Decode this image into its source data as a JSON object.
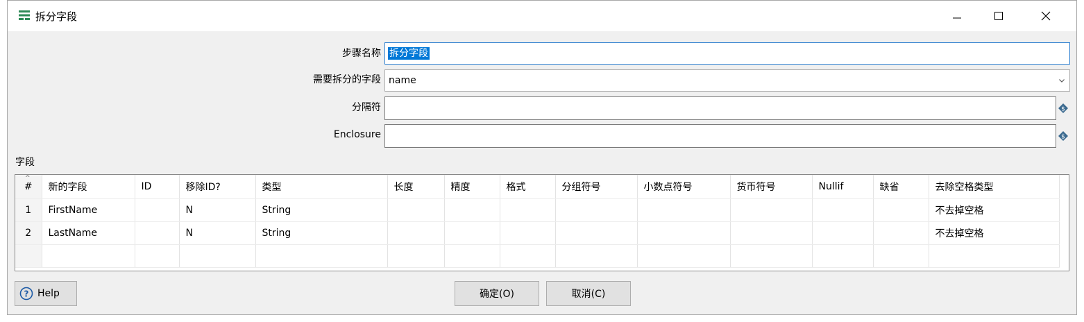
{
  "window": {
    "title": "拆分字段"
  },
  "form": {
    "step_name_label": "步骤名称",
    "step_name_value": "拆分字段",
    "field_to_split_label": "需要拆分的字段",
    "field_to_split_value": "name",
    "delimiter_label": "分隔符",
    "delimiter_value": "",
    "enclosure_label": "Enclosure",
    "enclosure_value": ""
  },
  "fields_section_label": "字段",
  "table": {
    "sort_indicator": "^",
    "columns": [
      "#",
      "新的字段",
      "ID",
      "移除ID?",
      "类型",
      "长度",
      "精度",
      "格式",
      "分组符号",
      "小数点符号",
      "货币符号",
      "Nullif",
      "缺省",
      "去除空格类型"
    ],
    "rows": [
      [
        "1",
        "FirstName",
        "",
        "N",
        "String",
        "",
        "",
        "",
        "",
        "",
        "",
        "",
        "",
        "不去掉空格"
      ],
      [
        "2",
        "LastName",
        "",
        "N",
        "String",
        "",
        "",
        "",
        "",
        "",
        "",
        "",
        "",
        "不去掉空格"
      ],
      [
        "",
        "",
        "",
        "",
        "",
        "",
        "",
        "",
        "",
        "",
        "",
        "",
        "",
        ""
      ]
    ]
  },
  "buttons": {
    "help": "Help",
    "ok": "确定(O)",
    "cancel": "取消(C)"
  },
  "icons": {
    "app": "split-fields-icon",
    "variable": "variable-dollar-icon",
    "help": "help-circle-icon"
  }
}
